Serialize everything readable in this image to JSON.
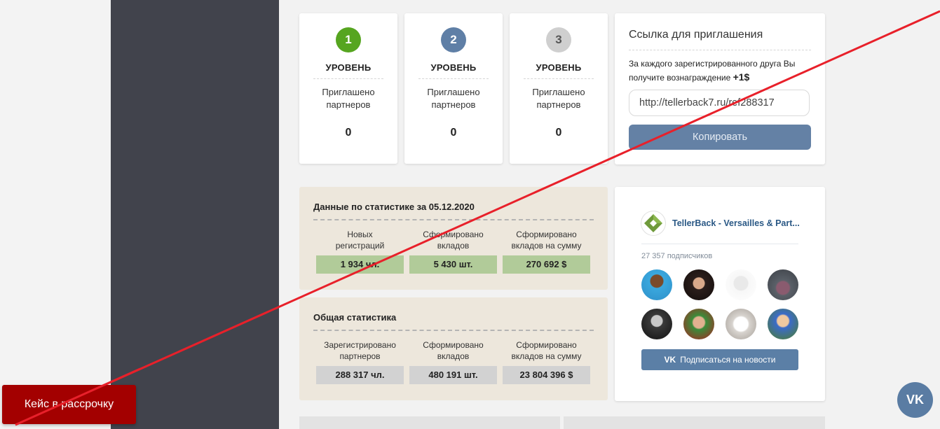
{
  "levels": [
    {
      "number": "1",
      "title": "УРОВЕНЬ",
      "desc_line1": "Приглашено",
      "desc_line2": "партнеров",
      "count": "0",
      "color": "#56a520"
    },
    {
      "number": "2",
      "title": "УРОВЕНЬ",
      "desc_line1": "Приглашено",
      "desc_line2": "партнеров",
      "count": "0",
      "color": "#5f7fa6"
    },
    {
      "number": "3",
      "title": "УРОВЕНЬ",
      "desc_line1": "Приглашено",
      "desc_line2": "партнеров",
      "count": "0",
      "color": "#cfcfcf"
    }
  ],
  "invite": {
    "title": "Ссылка для приглашения",
    "text": "За каждого зарегистрированного друга Вы получите вознаграждение",
    "reward": "+1$",
    "link": "http://tellerback7.ru/ref288317",
    "copy_label": "Копировать"
  },
  "daily_stats": {
    "title": "Данные по статистике за 05.12.2020",
    "columns": [
      {
        "label_line1": "Новых",
        "label_line2": "регистраций",
        "value": "1 934 чл."
      },
      {
        "label_line1": "Сформировано",
        "label_line2": "вкладов",
        "value": "5 430 шт."
      },
      {
        "label_line1": "Сформировано",
        "label_line2": "вкладов на сумму",
        "value": "270 692 $"
      }
    ]
  },
  "total_stats": {
    "title": "Общая статистика",
    "columns": [
      {
        "label_line1": "Зарегистрировано",
        "label_line2": "партнеров",
        "value": "288 317 чл."
      },
      {
        "label_line1": "Сформировано",
        "label_line2": "вкладов",
        "value": "480 191 шт."
      },
      {
        "label_line1": "Сформировано",
        "label_line2": "вкладов на сумму",
        "value": "23 804 396 $"
      }
    ]
  },
  "vk_widget": {
    "group_name": "TellerBack - Versailles & Part...",
    "subscribers": "27 357 подписчиков",
    "subscribe_label": "Подписаться на новости",
    "vk_mini": "VK",
    "logo_icon": "tellerback-diamond-icon"
  },
  "case_button": "Кейс в рассрочку",
  "vk_round": "VK",
  "colors": {
    "sidebar": "#41434c",
    "daily_value": "#b1cb99",
    "total_value": "#d2d2d2",
    "case_button": "#a30000",
    "diagonal_line": "#e8202a"
  }
}
